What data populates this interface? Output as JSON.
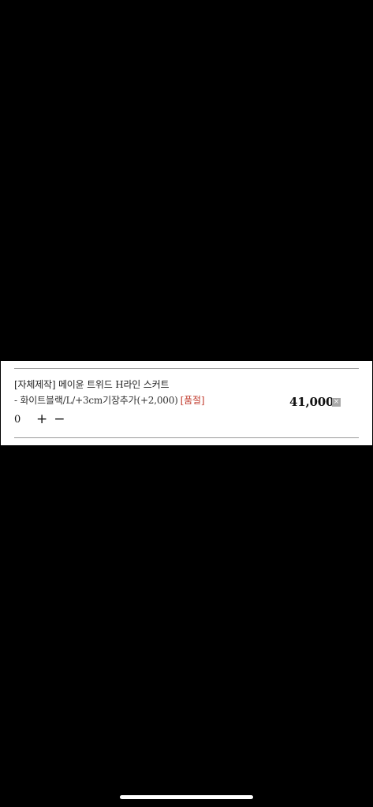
{
  "cart_item": {
    "product_name": "[자체제작] 메이윤 트위드 H라인 스커트",
    "option_text": "- 화이트블랙/L/+3cm기장추가(+2,000)",
    "soldout_label": "[품절]",
    "quantity": "0",
    "plus_symbol": "+",
    "minus_symbol": "−",
    "price": "41,000",
    "remove_symbol": "×",
    "remove_icon": "close-icon"
  },
  "colors": {
    "background": "#000000",
    "panel": "#ffffff",
    "soldout": "#c0392b",
    "remove_button": "#a8a8a8"
  }
}
